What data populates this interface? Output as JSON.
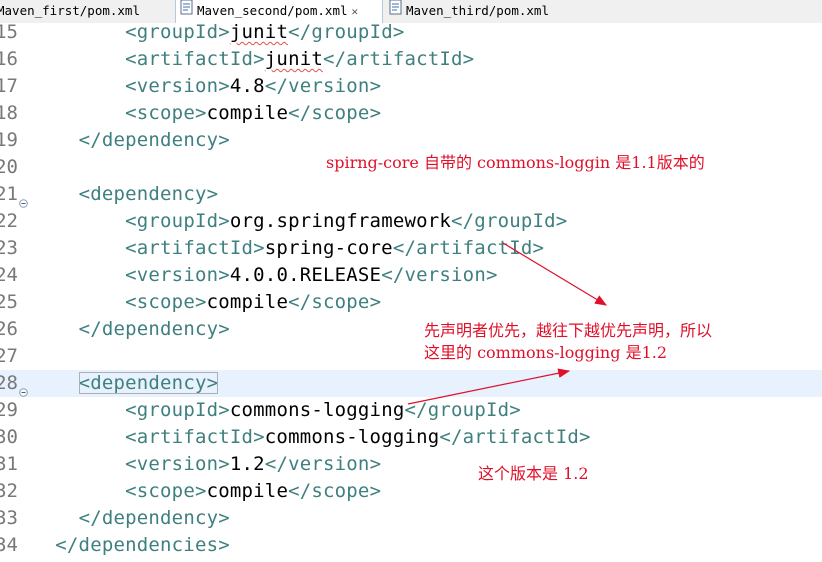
{
  "tabs": [
    {
      "label": "Maven_first/pom.xml",
      "active": false
    },
    {
      "label": "Maven_second/pom.xml",
      "active": true,
      "close": "✕"
    },
    {
      "label": "Maven_third/pom.xml",
      "active": false
    }
  ],
  "lines": [
    {
      "num": "15",
      "indent": "        ",
      "open": "<groupId>",
      "text": "junit",
      "close": "</groupId>",
      "squiggle": true
    },
    {
      "num": "16",
      "indent": "        ",
      "open": "<artifactId>",
      "text": "junit",
      "close": "</artifactId>",
      "squiggle": true
    },
    {
      "num": "17",
      "indent": "        ",
      "open": "<version>",
      "text": "4.8",
      "close": "</version>"
    },
    {
      "num": "18",
      "indent": "        ",
      "open": "<scope>",
      "text": "compile",
      "close": "</scope>"
    },
    {
      "num": "19",
      "indent": "    ",
      "open": "</dependency>",
      "text": "",
      "close": ""
    },
    {
      "num": "20",
      "indent": "",
      "open": "",
      "text": "",
      "close": ""
    },
    {
      "num": "21",
      "indent": "    ",
      "open": "<dependency>",
      "text": "",
      "close": "",
      "fold": true
    },
    {
      "num": "22",
      "indent": "        ",
      "open": "<groupId>",
      "text": "org.springframework",
      "close": "</groupId>"
    },
    {
      "num": "23",
      "indent": "        ",
      "open": "<artifactId>",
      "text": "spring-core",
      "close": "</artifactId>"
    },
    {
      "num": "24",
      "indent": "        ",
      "open": "<version>",
      "text": "4.0.0.RELEASE",
      "close": "</version>"
    },
    {
      "num": "25",
      "indent": "        ",
      "open": "<scope>",
      "text": "compile",
      "close": "</scope>"
    },
    {
      "num": "26",
      "indent": "    ",
      "open": "</dependency>",
      "text": "",
      "close": ""
    },
    {
      "num": "27",
      "indent": "",
      "open": "",
      "text": "",
      "close": ""
    },
    {
      "num": "28",
      "indent": "    ",
      "open": "<dependency>",
      "text": "",
      "close": "",
      "fold": true,
      "current": true
    },
    {
      "num": "29",
      "indent": "        ",
      "open": "<groupId>",
      "text": "commons-logging",
      "close": "</groupId>"
    },
    {
      "num": "30",
      "indent": "        ",
      "open": "<artifactId>",
      "text": "commons-logging",
      "close": "</artifactId>"
    },
    {
      "num": "31",
      "indent": "        ",
      "open": "<version>",
      "text": "1.2",
      "close": "</version>"
    },
    {
      "num": "32",
      "indent": "        ",
      "open": "<scope>",
      "text": "compile",
      "close": "</scope>"
    },
    {
      "num": "33",
      "indent": "    ",
      "open": "</dependency>",
      "text": "",
      "close": ""
    },
    {
      "num": "34",
      "indent": "  ",
      "open": "</dependencies>",
      "text": "",
      "close": ""
    }
  ],
  "annotations": {
    "note1": "spirng-core 自带的 commons-loggin 是1.1版本的",
    "note2_line1": "先声明者优先，越往下越优先声明，所以",
    "note2_line2": "这里的 commons-logging 是1.2",
    "note3": "这个版本是 1.2",
    "color": "#e0102a"
  },
  "colors": {
    "tag": "#3f7f7f",
    "text": "#000000",
    "line_number": "#787878",
    "current_line": "#e8f2fe"
  }
}
